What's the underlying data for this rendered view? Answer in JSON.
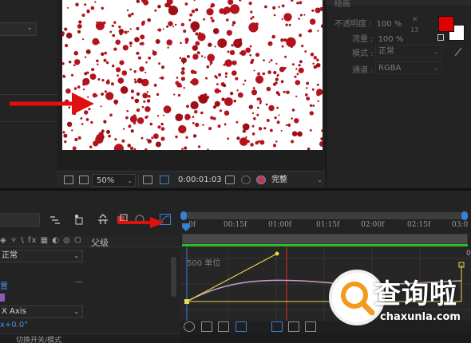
{
  "viewer_toolbar": {
    "zoom": "50%",
    "timecode": "0:00:01:03",
    "quality": "完整"
  },
  "paint_panel": {
    "title": "绘画",
    "opacity_label": "不透明度 :",
    "opacity_value": "100 %",
    "flow_label": "流量 :",
    "flow_value": "100 %",
    "mode_label": "模式 :",
    "mode_value": "正常",
    "channel_label": "通道 :",
    "channel_value": "RGBA",
    "brush_size": "13",
    "foreground_color": "#e10000",
    "background_color": "#ffffff"
  },
  "timeline": {
    "column_header_icons": "◈ ✧ \\ fx ▦ ◐ ◎ ⬡",
    "parent_label": "父级",
    "blend_mode": "正常",
    "property_position": "置",
    "property_dash": "—",
    "axis_mode": "X Axis",
    "rotation_value": "x+0.0°",
    "toggle_label": "切换开关/模式",
    "ruler_ticks": [
      "0f",
      "00:15f",
      "01:00f",
      "01:15f",
      "02:00f",
      "02:15f",
      "03:0"
    ],
    "graph_unit": "500 单位",
    "graph_right_value": "0"
  },
  "watermark": {
    "text": "查询啦",
    "url": "chaxunla.com"
  },
  "accent_colors": {
    "annotation_arrow": "#e01010",
    "timeline_blue": "#3a7fd5",
    "work_area_green": "#2bbd2b",
    "graph_yellow": "#e8d84a",
    "graph_pink": "#c9a0c8",
    "playhead_red": "#c62828"
  }
}
